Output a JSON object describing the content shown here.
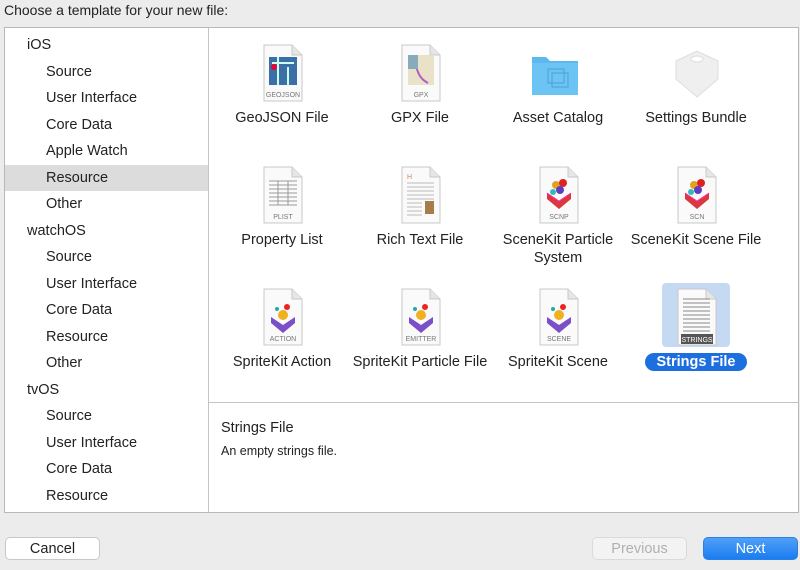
{
  "dialog": {
    "title": "Choose a template for your new file:"
  },
  "sidebar": {
    "items": [
      {
        "label": "iOS",
        "type": "group"
      },
      {
        "label": "Source",
        "type": "sub"
      },
      {
        "label": "User Interface",
        "type": "sub"
      },
      {
        "label": "Core Data",
        "type": "sub"
      },
      {
        "label": "Apple Watch",
        "type": "sub"
      },
      {
        "label": "Resource",
        "type": "sub",
        "selected": true
      },
      {
        "label": "Other",
        "type": "sub"
      },
      {
        "label": "watchOS",
        "type": "group"
      },
      {
        "label": "Source",
        "type": "sub"
      },
      {
        "label": "User Interface",
        "type": "sub"
      },
      {
        "label": "Core Data",
        "type": "sub"
      },
      {
        "label": "Resource",
        "type": "sub"
      },
      {
        "label": "Other",
        "type": "sub"
      },
      {
        "label": "tvOS",
        "type": "group"
      },
      {
        "label": "Source",
        "type": "sub"
      },
      {
        "label": "User Interface",
        "type": "sub"
      },
      {
        "label": "Core Data",
        "type": "sub"
      },
      {
        "label": "Resource",
        "type": "sub"
      }
    ]
  },
  "templates": [
    {
      "label": "GeoJSON File",
      "badge": "GEOJSON",
      "icon": "geojson-file-icon",
      "kind": "map"
    },
    {
      "label": "GPX File",
      "badge": "GPX",
      "icon": "gpx-file-icon",
      "kind": "map2"
    },
    {
      "label": "Asset Catalog",
      "badge": "",
      "icon": "folder-icon",
      "kind": "folder"
    },
    {
      "label": "Settings Bundle",
      "badge": "",
      "icon": "settings-bundle-icon",
      "kind": "lego"
    },
    {
      "label": "Property List",
      "badge": "PLIST",
      "icon": "plist-file-icon",
      "kind": "table"
    },
    {
      "label": "Rich Text File",
      "badge": "",
      "icon": "rich-text-file-icon",
      "kind": "text"
    },
    {
      "label": "SceneKit Particle System",
      "badge": "SCNP",
      "icon": "scenekit-particle-icon",
      "kind": "scn"
    },
    {
      "label": "SceneKit Scene File",
      "badge": "SCN",
      "icon": "scenekit-scene-icon",
      "kind": "scn"
    },
    {
      "label": "SpriteKit Action",
      "badge": "ACTION",
      "icon": "spritekit-action-icon",
      "kind": "sk"
    },
    {
      "label": "SpriteKit Particle File",
      "badge": "EMITTER",
      "icon": "spritekit-particle-icon",
      "kind": "sk"
    },
    {
      "label": "SpriteKit Scene",
      "badge": "SCENE",
      "icon": "spritekit-scene-icon",
      "kind": "sk"
    },
    {
      "label": "Strings File",
      "badge": "STRINGS",
      "icon": "strings-file-icon",
      "kind": "strings",
      "selected": true
    }
  ],
  "detail": {
    "title": "Strings File",
    "description": "An empty strings file."
  },
  "buttons": {
    "cancel": "Cancel",
    "previous": "Previous",
    "next": "Next"
  },
  "colors": {
    "accent": "#1d6fe0",
    "selection_bg": "#c6d9f3",
    "sidebar_selected": "#dcdcdc"
  }
}
